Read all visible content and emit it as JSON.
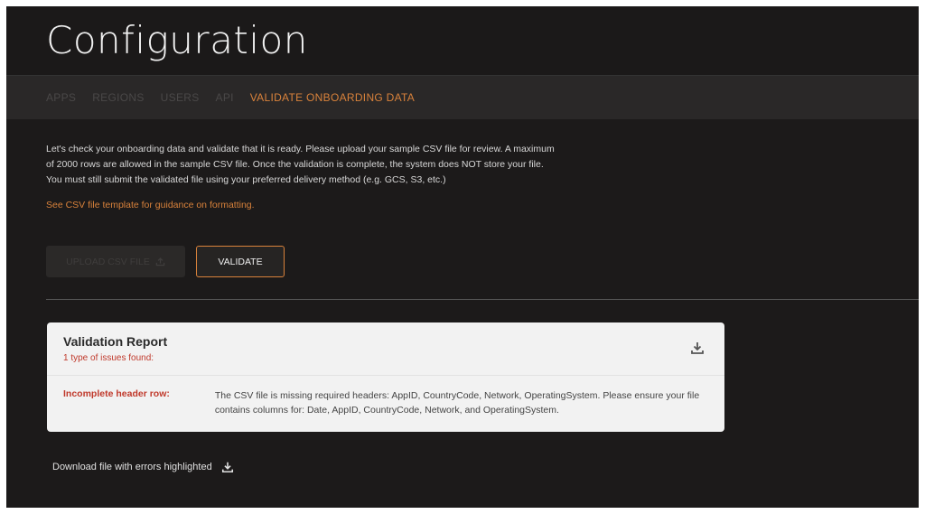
{
  "header": {
    "title": "Configuration"
  },
  "tabs": [
    {
      "label": "APPS",
      "active": false
    },
    {
      "label": "REGIONS",
      "active": false
    },
    {
      "label": "USERS",
      "active": false
    },
    {
      "label": "API",
      "active": false
    },
    {
      "label": "VALIDATE ONBOARDING DATA",
      "active": true
    }
  ],
  "main": {
    "description": "Let's check your onboarding data and validate that it is ready. Please upload your sample CSV file for review. A maximum of 2000 rows are allowed in the sample CSV file. Once the validation is complete, the system does NOT store your file. You must still submit the validated file using your preferred delivery method (e.g. GCS, S3, etc.)",
    "template_link": "See CSV file template for guidance on formatting.",
    "upload_label": "UPLOAD CSV FILE",
    "validate_label": "VALIDATE"
  },
  "report": {
    "title": "Validation Report",
    "summary": "1 type of issues found:",
    "issues": [
      {
        "label": "Incomplete header row:",
        "text": "The CSV file is missing required headers: AppID, CountryCode, Network, OperatingSystem. Please ensure your file contains columns for: Date, AppID, CountryCode, Network, and OperatingSystem."
      }
    ]
  },
  "footer": {
    "download_errors_label": "Download file with errors highlighted"
  },
  "colors": {
    "accent": "#d9823b",
    "error": "#c0392b",
    "background": "#1c1a1a"
  }
}
